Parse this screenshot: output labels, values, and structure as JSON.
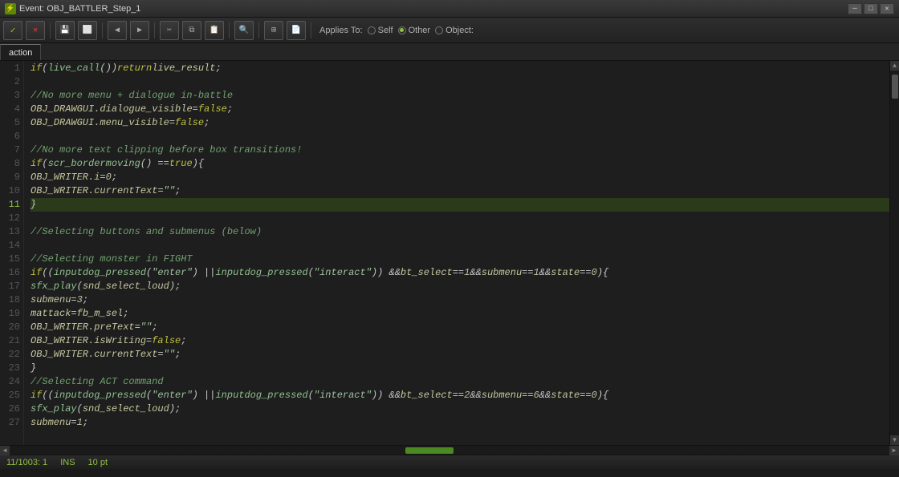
{
  "titleBar": {
    "title": "Event: OBJ_BATTLER_Step_1",
    "icon": "⚡"
  },
  "toolbar": {
    "appliesTo": "Applies To:",
    "radioOptions": [
      {
        "label": "Self",
        "selected": false
      },
      {
        "label": "Other",
        "selected": true
      },
      {
        "label": "Object:",
        "selected": false
      }
    ],
    "buttons": [
      {
        "icon": "✓",
        "name": "check-button",
        "class": "icon-check"
      },
      {
        "icon": "✕",
        "name": "cancel-button",
        "class": "icon-x"
      },
      {
        "icon": "💾",
        "name": "save-button"
      },
      {
        "icon": "⬜",
        "name": "new-button"
      },
      {
        "icon": "◀",
        "name": "back-button"
      },
      {
        "icon": "▶",
        "name": "forward-button"
      },
      {
        "icon": "✂",
        "name": "cut-button"
      },
      {
        "icon": "⧉",
        "name": "copy-button"
      },
      {
        "icon": "📋",
        "name": "paste-button"
      },
      {
        "icon": "🔍",
        "name": "search-button"
      },
      {
        "icon": "⊞",
        "name": "grid-button"
      },
      {
        "icon": "📄",
        "name": "code-button"
      }
    ]
  },
  "tabs": [
    {
      "label": "action",
      "active": true
    }
  ],
  "code": {
    "lines": [
      {
        "num": 1,
        "tokens": [
          {
            "t": "kw",
            "v": "if"
          },
          {
            "t": "plain",
            "v": " ("
          },
          {
            "t": "fn",
            "v": "live_call"
          },
          {
            "t": "plain",
            "v": "()) "
          },
          {
            "t": "kw",
            "v": "return"
          },
          {
            "t": "plain",
            "v": " "
          },
          {
            "t": "var",
            "v": "live_result"
          },
          {
            "t": "plain",
            "v": ";"
          }
        ]
      },
      {
        "num": 2,
        "tokens": []
      },
      {
        "num": 3,
        "tokens": [
          {
            "t": "cmt",
            "v": "//No more menu + dialogue in-battle"
          }
        ]
      },
      {
        "num": 4,
        "tokens": [
          {
            "t": "var",
            "v": "OBJ_DRAWGUI"
          },
          {
            "t": "plain",
            "v": "."
          },
          {
            "t": "var",
            "v": "dialogue_visible"
          },
          {
            "t": "plain",
            "v": " = "
          },
          {
            "t": "kw",
            "v": "false"
          },
          {
            "t": "plain",
            "v": ";"
          }
        ]
      },
      {
        "num": 5,
        "tokens": [
          {
            "t": "var",
            "v": "OBJ_DRAWGUI"
          },
          {
            "t": "plain",
            "v": "."
          },
          {
            "t": "var",
            "v": "menu_visible"
          },
          {
            "t": "plain",
            "v": " = "
          },
          {
            "t": "kw",
            "v": "false"
          },
          {
            "t": "plain",
            "v": ";"
          }
        ]
      },
      {
        "num": 6,
        "tokens": []
      },
      {
        "num": 7,
        "tokens": [
          {
            "t": "cmt",
            "v": "//No more text clipping before box transitions!"
          }
        ]
      },
      {
        "num": 8,
        "tokens": [
          {
            "t": "kw",
            "v": "if"
          },
          {
            "t": "plain",
            "v": "("
          },
          {
            "t": "fn",
            "v": "scr_bordermoving"
          },
          {
            "t": "plain",
            "v": "() == "
          },
          {
            "t": "kw",
            "v": "true"
          },
          {
            "t": "plain",
            "v": "){"
          }
        ]
      },
      {
        "num": 9,
        "tokens": [
          {
            "t": "plain",
            "v": "    "
          },
          {
            "t": "var",
            "v": "OBJ_WRITER"
          },
          {
            "t": "plain",
            "v": "."
          },
          {
            "t": "var",
            "v": "i"
          },
          {
            "t": "plain",
            "v": " = "
          },
          {
            "t": "num",
            "v": "0"
          },
          {
            "t": "plain",
            "v": ";"
          }
        ]
      },
      {
        "num": 10,
        "tokens": [
          {
            "t": "plain",
            "v": "    "
          },
          {
            "t": "var",
            "v": "OBJ_WRITER"
          },
          {
            "t": "plain",
            "v": "."
          },
          {
            "t": "var",
            "v": "currentText"
          },
          {
            "t": "plain",
            "v": " = "
          },
          {
            "t": "str",
            "v": "\"\""
          },
          {
            "t": "plain",
            "v": ";"
          }
        ]
      },
      {
        "num": 11,
        "tokens": [
          {
            "t": "plain",
            "v": "}"
          }
        ],
        "highlighted": true
      },
      {
        "num": 12,
        "tokens": []
      },
      {
        "num": 13,
        "tokens": [
          {
            "t": "cmt",
            "v": "//Selecting buttons and submenus (below)"
          }
        ]
      },
      {
        "num": 14,
        "tokens": []
      },
      {
        "num": 15,
        "tokens": [
          {
            "t": "cmt",
            "v": "//Selecting monster in FIGHT"
          }
        ]
      },
      {
        "num": 16,
        "tokens": [
          {
            "t": "kw",
            "v": "if"
          },
          {
            "t": "plain",
            "v": "(("
          },
          {
            "t": "fn",
            "v": "inputdog_pressed"
          },
          {
            "t": "plain",
            "v": "("
          },
          {
            "t": "str",
            "v": "\"enter\""
          },
          {
            "t": "plain",
            "v": ") || "
          },
          {
            "t": "fn",
            "v": "inputdog_pressed"
          },
          {
            "t": "plain",
            "v": "("
          },
          {
            "t": "str",
            "v": "\"interact\""
          },
          {
            "t": "plain",
            "v": ")) && "
          },
          {
            "t": "var",
            "v": "bt_select"
          },
          {
            "t": "plain",
            "v": " == "
          },
          {
            "t": "num",
            "v": "1"
          },
          {
            "t": "plain",
            "v": " && "
          },
          {
            "t": "var",
            "v": "submenu"
          },
          {
            "t": "plain",
            "v": " == "
          },
          {
            "t": "num",
            "v": "1"
          },
          {
            "t": "plain",
            "v": " && "
          },
          {
            "t": "var",
            "v": "state"
          },
          {
            "t": "plain",
            "v": " == "
          },
          {
            "t": "num",
            "v": "0"
          },
          {
            "t": "plain",
            "v": "){"
          }
        ]
      },
      {
        "num": 17,
        "tokens": [
          {
            "t": "plain",
            "v": "    "
          },
          {
            "t": "fn",
            "v": "sfx_play"
          },
          {
            "t": "plain",
            "v": "("
          },
          {
            "t": "var",
            "v": "snd_select_loud"
          },
          {
            "t": "plain",
            "v": ");"
          }
        ]
      },
      {
        "num": 18,
        "tokens": [
          {
            "t": "plain",
            "v": "    "
          },
          {
            "t": "var",
            "v": "submenu"
          },
          {
            "t": "plain",
            "v": " = "
          },
          {
            "t": "num",
            "v": "3"
          },
          {
            "t": "plain",
            "v": ";"
          }
        ]
      },
      {
        "num": 19,
        "tokens": [
          {
            "t": "plain",
            "v": "    "
          },
          {
            "t": "var",
            "v": "mattack"
          },
          {
            "t": "plain",
            "v": " = "
          },
          {
            "t": "var",
            "v": "fb_m_sel"
          },
          {
            "t": "plain",
            "v": ";"
          }
        ]
      },
      {
        "num": 20,
        "tokens": [
          {
            "t": "plain",
            "v": "    "
          },
          {
            "t": "var",
            "v": "OBJ_WRITER"
          },
          {
            "t": "plain",
            "v": "."
          },
          {
            "t": "var",
            "v": "preText"
          },
          {
            "t": "plain",
            "v": " = "
          },
          {
            "t": "str",
            "v": "\"\""
          },
          {
            "t": "plain",
            "v": ";"
          }
        ]
      },
      {
        "num": 21,
        "tokens": [
          {
            "t": "plain",
            "v": "    "
          },
          {
            "t": "var",
            "v": "OBJ_WRITER"
          },
          {
            "t": "plain",
            "v": "."
          },
          {
            "t": "var",
            "v": "isWriting"
          },
          {
            "t": "plain",
            "v": " = "
          },
          {
            "t": "kw",
            "v": "false"
          },
          {
            "t": "plain",
            "v": ";"
          }
        ]
      },
      {
        "num": 22,
        "tokens": [
          {
            "t": "plain",
            "v": "    "
          },
          {
            "t": "var",
            "v": "OBJ_WRITER"
          },
          {
            "t": "plain",
            "v": "."
          },
          {
            "t": "var",
            "v": "currentText"
          },
          {
            "t": "plain",
            "v": " = "
          },
          {
            "t": "str",
            "v": "\"\""
          },
          {
            "t": "plain",
            "v": ";"
          }
        ]
      },
      {
        "num": 23,
        "tokens": [
          {
            "t": "plain",
            "v": "}"
          }
        ]
      },
      {
        "num": 24,
        "tokens": [
          {
            "t": "cmt",
            "v": "//Selecting ACT command"
          }
        ]
      },
      {
        "num": 25,
        "tokens": [
          {
            "t": "kw",
            "v": "if"
          },
          {
            "t": "plain",
            "v": "(("
          },
          {
            "t": "fn",
            "v": "inputdog_pressed"
          },
          {
            "t": "plain",
            "v": "("
          },
          {
            "t": "str",
            "v": "\"enter\""
          },
          {
            "t": "plain",
            "v": ") || "
          },
          {
            "t": "fn",
            "v": "inputdog_pressed"
          },
          {
            "t": "plain",
            "v": "("
          },
          {
            "t": "str",
            "v": "\"interact\""
          },
          {
            "t": "plain",
            "v": ")) && "
          },
          {
            "t": "var",
            "v": "bt_select"
          },
          {
            "t": "plain",
            "v": " == "
          },
          {
            "t": "num",
            "v": "2"
          },
          {
            "t": "plain",
            "v": " && "
          },
          {
            "t": "var",
            "v": "submenu"
          },
          {
            "t": "plain",
            "v": " == "
          },
          {
            "t": "num",
            "v": "6"
          },
          {
            "t": "plain",
            "v": " && "
          },
          {
            "t": "var",
            "v": "state"
          },
          {
            "t": "plain",
            "v": " == "
          },
          {
            "t": "num",
            "v": "0"
          },
          {
            "t": "plain",
            "v": "){"
          }
        ]
      },
      {
        "num": 26,
        "tokens": [
          {
            "t": "plain",
            "v": "    "
          },
          {
            "t": "fn",
            "v": "sfx_play"
          },
          {
            "t": "plain",
            "v": "("
          },
          {
            "t": "var",
            "v": "snd_select_loud"
          },
          {
            "t": "plain",
            "v": ");"
          }
        ]
      },
      {
        "num": 27,
        "tokens": [
          {
            "t": "plain",
            "v": "    "
          },
          {
            "t": "var",
            "v": "submenu"
          },
          {
            "t": "plain",
            "v": " = "
          },
          {
            "t": "num",
            "v": "1"
          },
          {
            "t": "plain",
            "v": ";"
          }
        ]
      }
    ]
  },
  "statusBar": {
    "position": "11/1003:  1",
    "mode": "INS",
    "size": "10 pt"
  }
}
